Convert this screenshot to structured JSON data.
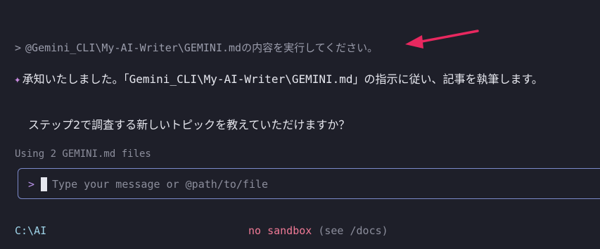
{
  "history": {
    "user_prompt_symbol": ">",
    "user_message": "@Gemini_CLI\\My-AI-Writer\\GEMINI.mdの内容を実行してください。",
    "response_symbol": "✦",
    "response_text": "承知いたしました。「Gemini_CLI\\My-AI-Writer\\GEMINI.md」の指示に従い、記事を執筆します。",
    "question_text": "ステップ2で調査する新しいトピックを教えていただけますか？"
  },
  "context": {
    "text": "Using 2 GEMINI.md files"
  },
  "input": {
    "prompt_symbol": ">",
    "placeholder": "Type your message or @path/to/file",
    "value": ""
  },
  "footer": {
    "cwd": "C:\\AI",
    "sandbox_status": "no sandbox",
    "sandbox_hint": "(see /docs)"
  },
  "annotation": {
    "arrow_icon": "red-arrow-icon",
    "arrow_color": "#e8285f"
  },
  "colors": {
    "background": "#1e1f29",
    "input_border": "#7b89c9",
    "accent_purple": "#b892e8",
    "sandbox_red": "#f07a96",
    "path_cyan": "#9fd3e8"
  }
}
